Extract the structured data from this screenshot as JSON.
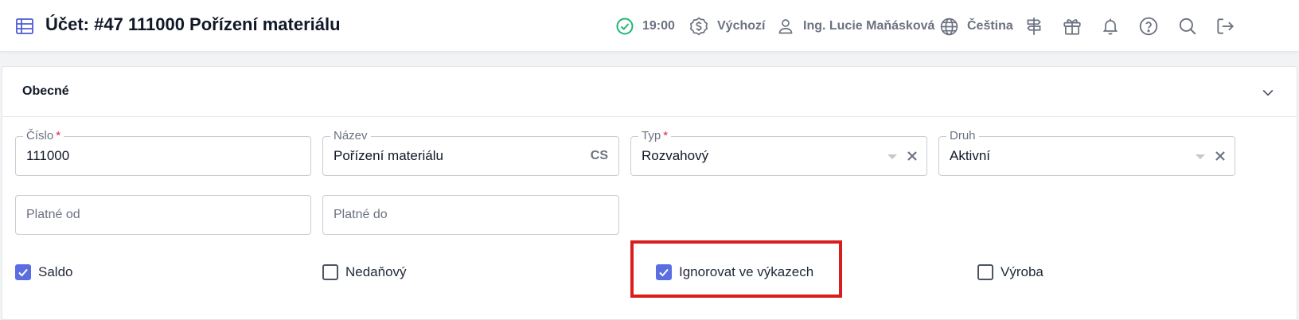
{
  "header": {
    "title": "Účet: #47 111000 Pořízení materiálu",
    "status_time": "19:00",
    "currency_label": "Výchozí",
    "user_name": "Ing. Lucie Maňásková",
    "language": "Čeština"
  },
  "section": {
    "title": "Obecné"
  },
  "fields": {
    "cislo": {
      "label": "Číslo",
      "required": "*",
      "value": "111000"
    },
    "nazev": {
      "label": "Název",
      "value": "Pořízení materiálu",
      "lang": "CS"
    },
    "typ": {
      "label": "Typ",
      "required": "*",
      "value": "Rozvahový"
    },
    "druh": {
      "label": "Druh",
      "value": "Aktivní"
    },
    "platne_od": {
      "placeholder": "Platné od"
    },
    "platne_do": {
      "placeholder": "Platné do"
    }
  },
  "checkboxes": {
    "saldo": {
      "label": "Saldo",
      "checked": true
    },
    "nedanovy": {
      "label": "Nedaňový",
      "checked": false
    },
    "ignorovat": {
      "label": "Ignorovat ve výkazech",
      "checked": true
    },
    "vyroba": {
      "label": "Výroba",
      "checked": false
    }
  },
  "colors": {
    "accent": "#5b6ee1",
    "status_ok": "#22b573",
    "highlight": "#d91c1c",
    "required": "#e11d48"
  },
  "icons": [
    "table-icon",
    "check-circle-icon",
    "currency-icon",
    "user-icon",
    "globe-icon",
    "signpost-icon",
    "gift-icon",
    "bell-icon",
    "help-icon",
    "search-icon",
    "logout-icon",
    "chevron-down-icon",
    "clear-icon",
    "checkmark-icon"
  ]
}
